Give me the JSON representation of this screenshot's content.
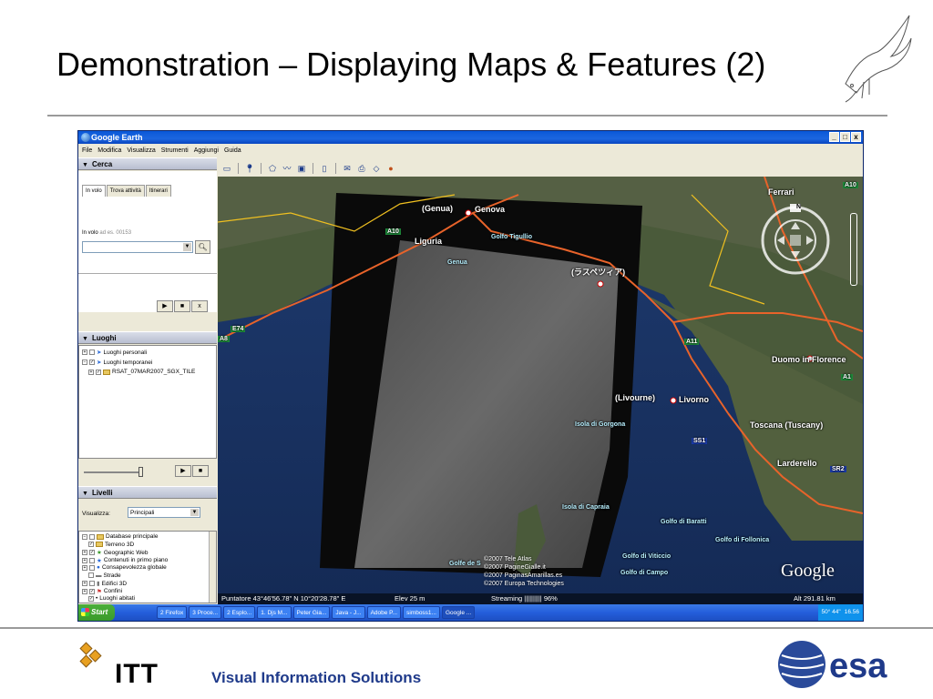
{
  "slide": {
    "title": "Demonstration – Displaying Maps & Features (2)",
    "footer_text": "Visual Information Solutions",
    "itt_logo_text": "ITT",
    "esa_logo_text": "esa"
  },
  "window": {
    "title": "Google Earth",
    "controls": [
      "_",
      "□",
      "x"
    ],
    "menu": [
      "File",
      "Modifica",
      "Visualizza",
      "Strumenti",
      "Aggiungi",
      "Guida"
    ]
  },
  "cerca": {
    "header": "Cerca",
    "tabs": [
      "In volo",
      "Trova attività",
      "Itinerari"
    ],
    "label": "In volo",
    "hint": "ad es. 00153",
    "search_icon": "magnifier-icon",
    "controls": [
      "▶",
      "■",
      "x"
    ]
  },
  "luoghi": {
    "header": "Luoghi",
    "items": [
      "Luoghi personali",
      "Luoghi temporanei",
      "RSAT_07MAR2007_SGX_TILE"
    ],
    "controls": [
      "▶",
      "■"
    ]
  },
  "livelli": {
    "header": "Livelli",
    "visualizza_label": "Visualizza:",
    "visualizza_value": "Principali",
    "items": [
      "Database principale",
      "Terreno 3D",
      "Geographic Web",
      "Contenuti in primo piano",
      "Consapevolezza globale",
      "Strade",
      "Edifici 3D",
      "Confini",
      "Luoghi abitati"
    ]
  },
  "map": {
    "labels": {
      "genova_it": "(Genua)",
      "genova": "Genova",
      "liguria": "Liguria",
      "golfo_tigullio": "Golfo Tigullio",
      "genua": "Genua",
      "la_spezia": "(ラスペツィア)",
      "livorne": "(Livourne)",
      "livorno": "Livorno",
      "isola_gorgona": "Isola di Gorgona",
      "isola_capraia": "Isola di Capraia",
      "golfo_baratti": "Golfo di Baratti",
      "golfo_follonica": "Golfo di Follonica",
      "golfo_viticcio": "Golfo di Viticcio",
      "golfo_campo": "Golfo di Campo",
      "golfe_de": "Golfe de S",
      "duomo": "Duomo in Florence",
      "toscana": "Toscana (Tuscany)",
      "larderello": "Larderello",
      "ferrara": "Ferrari"
    },
    "road_badges": [
      "A10",
      "E74",
      "A8",
      "A11",
      "A1",
      "SS1",
      "SR2",
      "A10"
    ],
    "credits": [
      "©2007 Tele Atlas",
      "©2007 PagineGialle.it",
      "©2007 PaginasAmarillas.es",
      "©2007 Europa Technologies"
    ],
    "brand": "Google",
    "nav_north": "N",
    "status": {
      "pointer": "Puntatore 43°46'56.78\" N    10°20'28.78\" E",
      "elevation": "Elev   25 m",
      "streaming": "Streaming |||||||||| 96%",
      "altitude": "Alt  291.81 km"
    }
  },
  "taskbar": {
    "start": "Start",
    "tasks": [
      "2 Firefox",
      "3 Proce...",
      "2 Esplo...",
      "1. Djs M...",
      "Peter Gia...",
      "Java - J...",
      "Adobe P...",
      "simboss1...",
      "Google ..."
    ],
    "tray": [
      "50° 44\"",
      "16.56"
    ]
  },
  "colors": {
    "titlebar": "#0a58d8",
    "road": "#e8632a",
    "boundary": "#f0c020",
    "water_label": "#b8f0ff",
    "footer_text": "#1f3a8a"
  }
}
